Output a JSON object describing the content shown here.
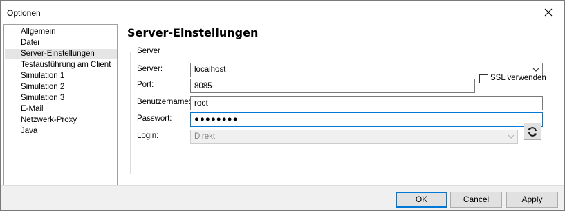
{
  "window": {
    "title": "Optionen"
  },
  "sidebar": {
    "items": [
      {
        "label": "Allgemein",
        "selected": false
      },
      {
        "label": "Datei",
        "selected": false
      },
      {
        "label": "Server-Einstellungen",
        "selected": true
      },
      {
        "label": "Testausführung am Client",
        "selected": false
      },
      {
        "label": "Simulation 1",
        "selected": false
      },
      {
        "label": "Simulation 2",
        "selected": false
      },
      {
        "label": "Simulation 3",
        "selected": false
      },
      {
        "label": "E-Mail",
        "selected": false
      },
      {
        "label": "Netzwerk-Proxy",
        "selected": false
      },
      {
        "label": "Java",
        "selected": false
      }
    ]
  },
  "main": {
    "title": "Server-Einstellungen",
    "group": {
      "legend": "Server",
      "server_label": "Server:",
      "server_value": "localhost",
      "port_label": "Port:",
      "port_value": "8085",
      "ssl_label": "SSL verwenden",
      "ssl_checked": false,
      "username_label": "Benutzername:",
      "username_value": "root",
      "password_label": "Passwort:",
      "password_value": "●●●●●●●●",
      "login_label": "Login:",
      "login_value": "Direkt"
    }
  },
  "footer": {
    "ok_label": "OK",
    "cancel_label": "Cancel",
    "apply_label": "Apply"
  },
  "icons": {
    "close": "close-icon",
    "dropdown": "chevron-down-icon",
    "refresh": "refresh-icon"
  },
  "colors": {
    "focus_border": "#0078d7",
    "selected_item": "#e5e5e5",
    "footer_bg": "#f0f0f0"
  }
}
